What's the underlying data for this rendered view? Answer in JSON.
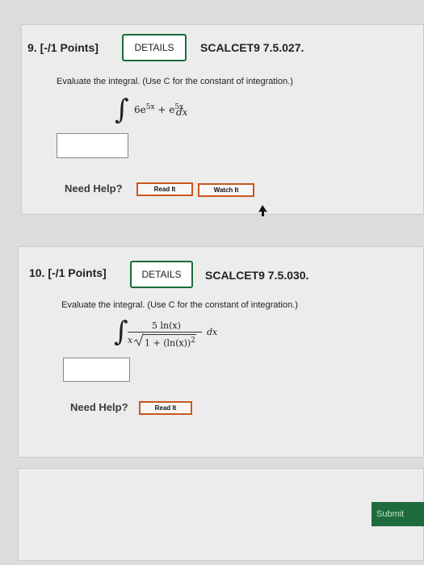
{
  "q9": {
    "header": "9. [-/1 Points]",
    "details_label": "DETAILS",
    "course_code": "SCALCET9 7.5.027.",
    "prompt": "Evaluate the integral. (Use C for the constant of integration.)",
    "integrand_coef": "6e",
    "integrand_exp1": "5x",
    "integrand_plus": " + e",
    "integrand_exp2": "5x",
    "differential": "dx",
    "need_help": "Need Help?",
    "read_it": "Read It",
    "watch_it": "Watch It"
  },
  "q10": {
    "header": "10. [-/1 Points]",
    "details_label": "DETAILS",
    "course_code": "SCALCET9 7.5.030.",
    "prompt": "Evaluate the integral. (Use C for the constant of integration.)",
    "numerator": "5 ln(x)",
    "denom_x": "x",
    "denom_radicand": "1 + (ln(x))",
    "denom_power": "2",
    "differential": "dx",
    "need_help": "Need Help?",
    "read_it": "Read It"
  },
  "submit_label": "Submit"
}
